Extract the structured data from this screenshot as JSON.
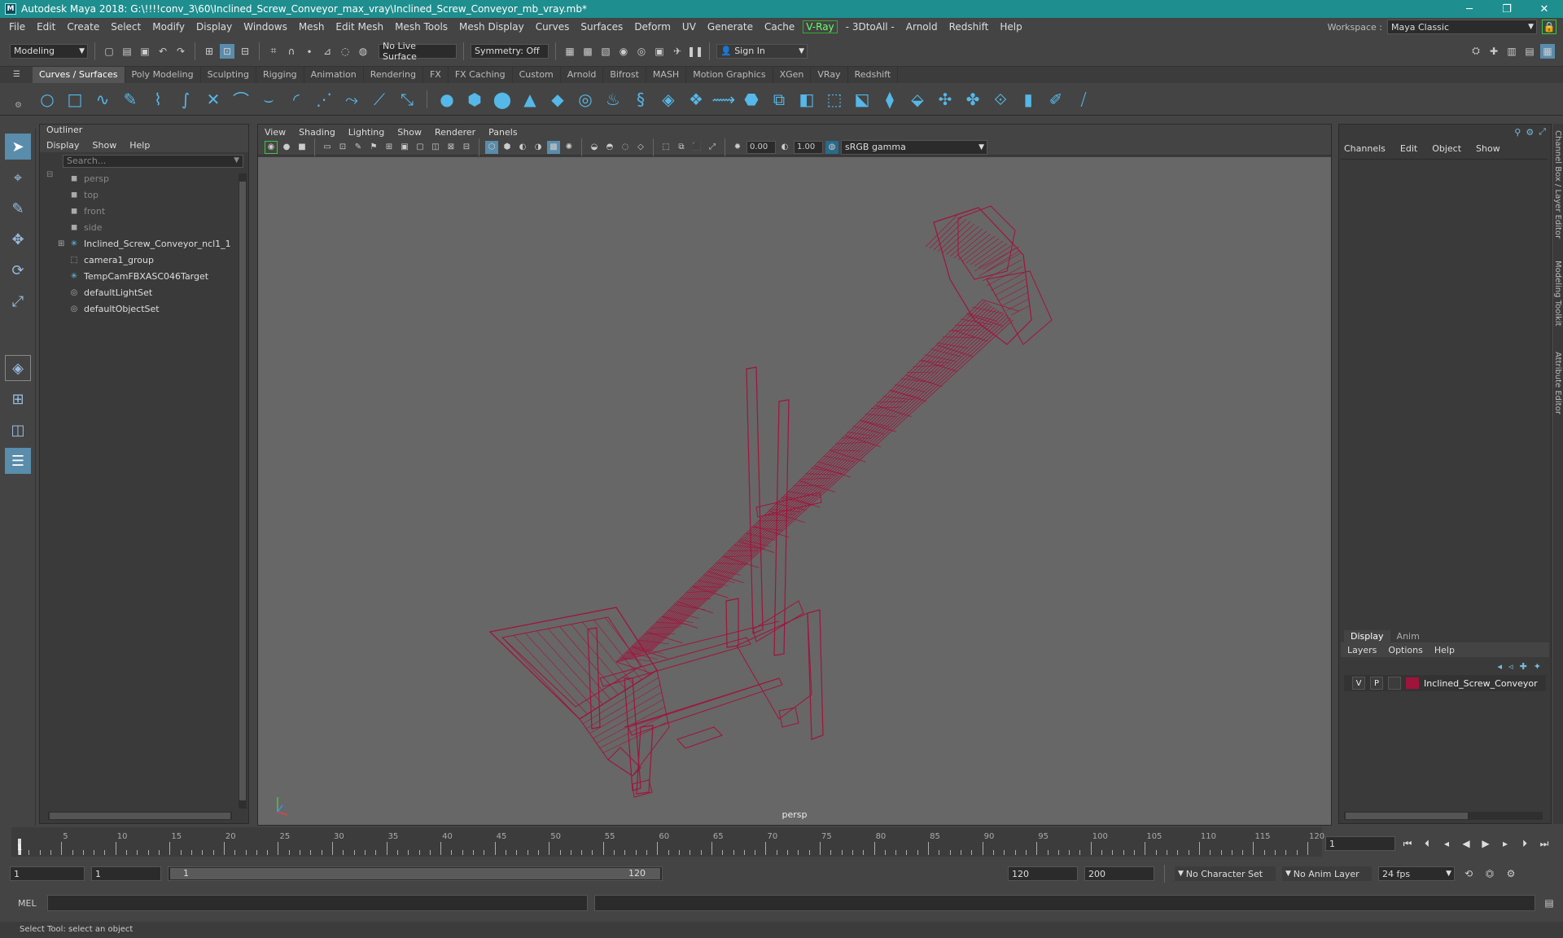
{
  "window": {
    "title": "Autodesk Maya 2018: G:\\!!!!conv_3\\60\\Inclined_Screw_Conveyor_max_vray\\Inclined_Screw_Conveyor_mb_vray.mb*",
    "app_logo": "M",
    "minimize": "─",
    "maximize": "❐",
    "close": "✕"
  },
  "menubar": {
    "items": [
      "File",
      "Edit",
      "Create",
      "Select",
      "Modify",
      "Display",
      "Windows",
      "Mesh",
      "Edit Mesh",
      "Mesh Tools",
      "Mesh Display",
      "Curves",
      "Surfaces",
      "Deform",
      "UV",
      "Generate",
      "Cache"
    ],
    "vray": "V-Ray",
    "items2": [
      "- 3DtoAll -",
      "Arnold",
      "Redshift",
      "Help"
    ],
    "workspace_label": "Workspace :",
    "workspace_value": "Maya Classic"
  },
  "status": {
    "mode": "Modeling",
    "live_surface": "No Live Surface",
    "symmetry": "Symmetry: Off",
    "sign_in": "Sign In"
  },
  "shelf": {
    "tabs": [
      "Curves / Surfaces",
      "Poly Modeling",
      "Sculpting",
      "Rigging",
      "Animation",
      "Rendering",
      "FX",
      "FX Caching",
      "Custom",
      "Arnold",
      "Bifrost",
      "MASH",
      "Motion Graphics",
      "XGen",
      "VRay",
      "Redshift"
    ],
    "active": 0
  },
  "outliner": {
    "title": "Outliner",
    "menu": [
      "Display",
      "Show",
      "Help"
    ],
    "search_placeholder": "Search...",
    "items": [
      {
        "label": "persp",
        "dim": true,
        "icon": "camera-icon"
      },
      {
        "label": "top",
        "dim": true,
        "icon": "camera-icon"
      },
      {
        "label": "front",
        "dim": true,
        "icon": "camera-icon"
      },
      {
        "label": "side",
        "dim": true,
        "icon": "camera-icon"
      },
      {
        "label": "Inclined_Screw_Conveyor_ncl1_1",
        "dim": false,
        "icon": "transform-icon",
        "expandable": true
      },
      {
        "label": "camera1_group",
        "dim": false,
        "icon": "group-icon"
      },
      {
        "label": "TempCamFBXASC046Target",
        "dim": false,
        "icon": "transform-icon"
      },
      {
        "label": "defaultLightSet",
        "dim": false,
        "icon": "set-icon"
      },
      {
        "label": "defaultObjectSet",
        "dim": false,
        "icon": "set-icon"
      }
    ]
  },
  "viewport": {
    "menu": [
      "View",
      "Shading",
      "Lighting",
      "Show",
      "Renderer",
      "Panels"
    ],
    "exposure": "0.00",
    "gamma": "1.00",
    "color_space": "sRGB gamma",
    "camera_label": "persp",
    "wire_color": "#a0143c",
    "bg_color": "#676767"
  },
  "channelbox": {
    "menu": [
      "Channels",
      "Edit",
      "Object",
      "Show"
    ]
  },
  "layers": {
    "tabs": [
      "Display",
      "Anim"
    ],
    "menu": [
      "Layers",
      "Options",
      "Help"
    ],
    "row": {
      "v": "V",
      "p": "P",
      "name": "Inclined_Screw_Conveyor",
      "color": "#a0143c"
    }
  },
  "sidetabs": [
    "Channel Box / Layer Editor",
    "Modeling Toolkit",
    "Attribute Editor"
  ],
  "timeline": {
    "ticks": [
      "5",
      "10",
      "15",
      "20",
      "25",
      "30",
      "35",
      "40",
      "45",
      "50",
      "55",
      "60",
      "65",
      "70",
      "75",
      "80",
      "85",
      "90",
      "95",
      "100",
      "105",
      "110",
      "115",
      "120"
    ],
    "current_frame": "1"
  },
  "range": {
    "start": "1",
    "start2": "1",
    "slider_start": "1",
    "slider_end": "120",
    "end": "120",
    "end2": "200",
    "character_set": "No Character Set",
    "anim_layer": "No Anim Layer",
    "fps": "24 fps"
  },
  "cmd": {
    "label": "MEL"
  },
  "help": {
    "text": "Select Tool: select an object"
  }
}
